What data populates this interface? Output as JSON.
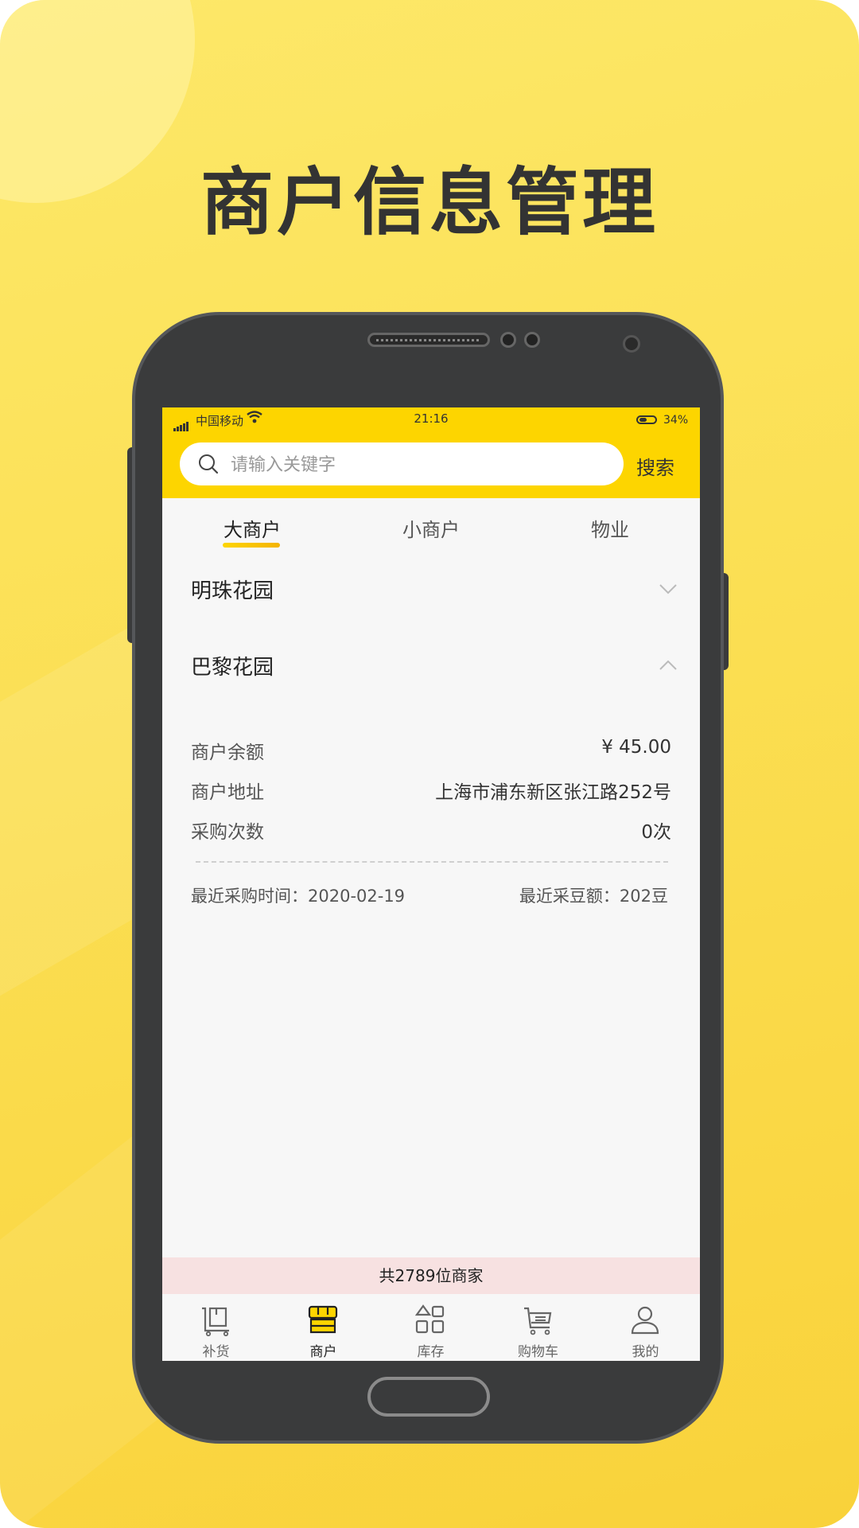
{
  "promo": {
    "headline": "商户信息管理"
  },
  "status_bar": {
    "carrier": "中国移动",
    "time": "21:16",
    "battery": "34%"
  },
  "search": {
    "placeholder": "请输入关键字",
    "button_label": "搜索"
  },
  "tabs": [
    {
      "label": "大商户",
      "active": true
    },
    {
      "label": "小商户",
      "active": false
    },
    {
      "label": "物业",
      "active": false
    }
  ],
  "groups": [
    {
      "name": "明珠花园",
      "expanded": false
    },
    {
      "name": "巴黎花园",
      "expanded": true
    }
  ],
  "detail": {
    "balance_label": "商户余额",
    "balance_value": "¥ 45.00",
    "address_label": "商户地址",
    "address_value": "上海市浦东新区张江路252号",
    "purchases_label": "采购次数",
    "purchases_value": "0次",
    "last_purchase": "最近采购时间：2020-02-19",
    "last_beans": "最近采豆额：202豆"
  },
  "total": "共2789位商家",
  "nav": [
    {
      "label": "补货",
      "icon": "restock-icon",
      "active": false
    },
    {
      "label": "商户",
      "icon": "store-icon",
      "active": true
    },
    {
      "label": "库存",
      "icon": "inventory-icon",
      "active": false
    },
    {
      "label": "购物车",
      "icon": "cart-icon",
      "active": false
    },
    {
      "label": "我的",
      "icon": "profile-icon",
      "active": false
    }
  ],
  "colors": {
    "accent": "#fdd500",
    "promo_bg": "#fbdf53",
    "total_bar": "#f7e1e1"
  }
}
